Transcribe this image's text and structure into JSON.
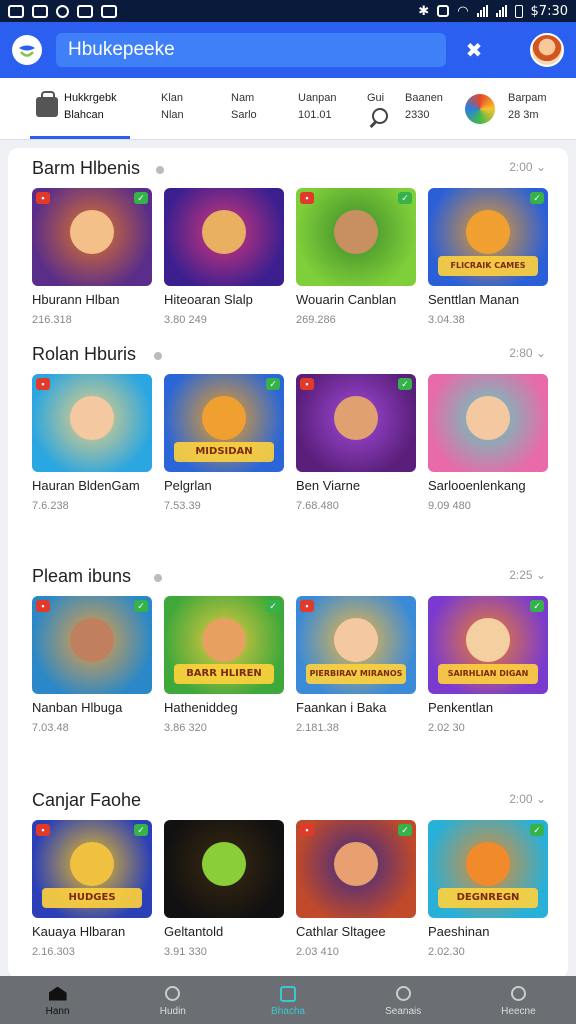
{
  "status": {
    "time": "$7:30"
  },
  "header": {
    "search_value": "Hbukepeeke"
  },
  "categories": [
    {
      "line1": "Hukkrgebk",
      "line2": "Blahcan"
    },
    {
      "line1": "Klan",
      "line2": "Nlan"
    },
    {
      "line1": "Nam",
      "line2": "Sarlo"
    },
    {
      "line1": "Uanpan",
      "line2": "101.01"
    },
    {
      "line1": "Gui",
      "line2": ""
    },
    {
      "line1": "Baanen",
      "line2": "2330"
    },
    {
      "line1": "Barpam",
      "line2": "28 3m"
    }
  ],
  "sections": [
    {
      "title": "Barm Hlbenis",
      "more": "2:00",
      "tiles": [
        {
          "name": "Hburann Hlban",
          "meta": "216.318"
        },
        {
          "name": "Hiteoaran Slalp",
          "meta": "3.80 249"
        },
        {
          "name": "Wouarin Canblan",
          "meta": "269.286"
        },
        {
          "name": "Senttlan Manan",
          "meta": "3.04.38",
          "banner": "FLICRAIK CAMES"
        }
      ]
    },
    {
      "title": "Rolan Hburis",
      "more": "2:80",
      "tiles": [
        {
          "name": "Hauran BldenGam",
          "meta": "7.6.238"
        },
        {
          "name": "Pelgrlan",
          "meta": "7.53.39"
        },
        {
          "name": "Ben Viarne",
          "meta": "7.68.480"
        },
        {
          "name": "Sarlooenlenkang",
          "meta": "9.09 480"
        }
      ]
    },
    {
      "title": "Pleam ibuns",
      "more": "2:25",
      "tiles": [
        {
          "name": "Nanban Hlbuga",
          "meta": "7.03.48"
        },
        {
          "name": "Hatheniddeg",
          "meta": "3.86 320"
        },
        {
          "name": "Faankan i Baka",
          "meta": "2.181.38"
        },
        {
          "name": "Penkentlan",
          "meta": "2.02 30"
        }
      ]
    },
    {
      "title": "Canjar Faohe",
      "more": "2:00",
      "tiles": [
        {
          "name": "Kauaya Hlbaran",
          "meta": "2.16.303"
        },
        {
          "name": "Geltantold",
          "meta": "3.91 330"
        },
        {
          "name": "Cathlar Sltagee",
          "meta": "2.03 410"
        },
        {
          "name": "Paeshinan",
          "meta": "2.02.30"
        }
      ]
    }
  ],
  "tile_banners": [
    "",
    "",
    "",
    "FLICRAIK CAMES",
    "",
    "MIDSIDAN",
    "",
    "",
    "",
    "BARR HLIREN",
    "PIERBIRAV MIRANOS",
    "SAIRHLIAN DIGAN",
    "HUDGES",
    "",
    "",
    "DEGNREGN"
  ],
  "bottom_nav": [
    {
      "label": "Hann"
    },
    {
      "label": "Hudin"
    },
    {
      "label": "Bhacha"
    },
    {
      "label": "Seanais"
    },
    {
      "label": "Heecne"
    }
  ]
}
